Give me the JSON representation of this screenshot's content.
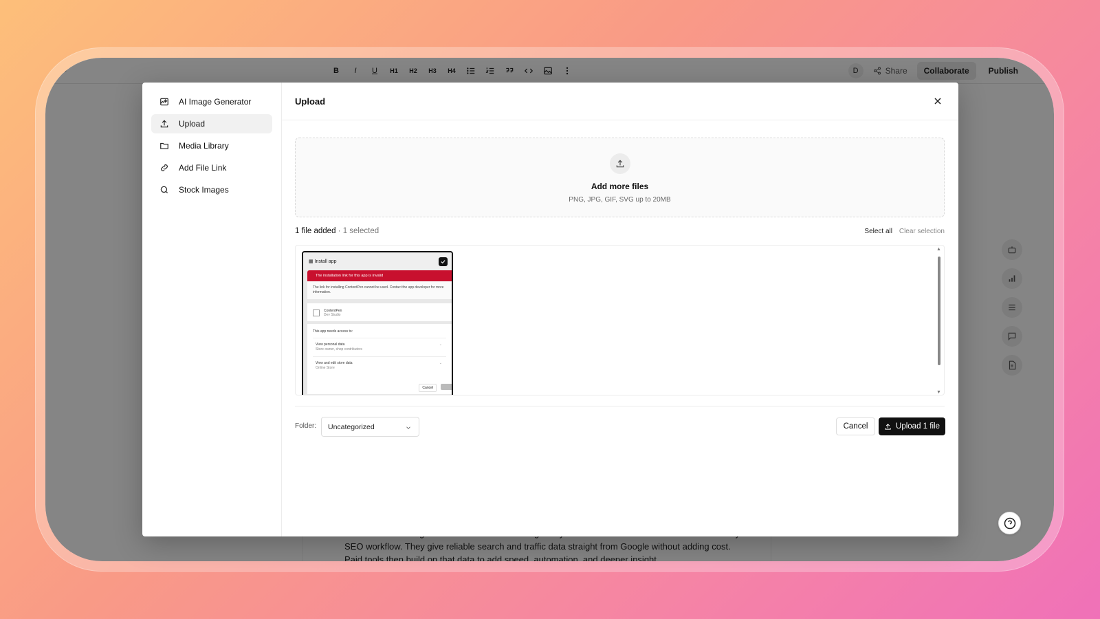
{
  "editor": {
    "toolbar": [
      "B",
      "I",
      "U",
      "H1",
      "H2",
      "H3",
      "H4"
    ],
    "avatar": "D",
    "share_label": "Share",
    "collaborate_label": "Collaborate",
    "publish_label": "Publish",
    "doc_text": "Free tools like Google Search Console and Google Keyword Planner form the base for almost every SEO workflow. They give reliable search and traffic data straight from Google without adding cost. Paid tools then build on that data to add speed, automation, and deeper insight."
  },
  "modal": {
    "title": "Upload",
    "sidebar": [
      {
        "label": "AI Image Generator",
        "icon": "ai-image-icon"
      },
      {
        "label": "Upload",
        "icon": "upload-icon",
        "active": true
      },
      {
        "label": "Media Library",
        "icon": "folder-icon"
      },
      {
        "label": "Add File Link",
        "icon": "link-icon"
      },
      {
        "label": "Stock Images",
        "icon": "search-icon"
      }
    ],
    "dropzone": {
      "title": "Add more files",
      "subtitle": "PNG, JPG, GIF, SVG up to 20MB"
    },
    "files": {
      "count_text": "1 file added",
      "selected_text": " · 1 selected",
      "select_all": "Select all",
      "clear_selection": "Clear selection"
    },
    "thumbnail": {
      "header": "Install app",
      "alert": "The installation link for this app is invalid",
      "body": "The link for installing ContentPen cannot be used. Contact the app developer for more information.",
      "app_name": "ContentPen",
      "app_sub": "Dev Studio",
      "access_title": "This app needs access to:",
      "rows": [
        {
          "title": "View personal data",
          "sub": "Store owner, shop contributors"
        },
        {
          "title": "View and edit store data",
          "sub": "Online Store"
        }
      ],
      "cancel": "Cancel"
    },
    "footer": {
      "folder_label": "Folder:",
      "folder_value": "Uncategorized",
      "cancel_label": "Cancel",
      "upload_label": "Upload 1 file"
    }
  },
  "help_label": "?"
}
